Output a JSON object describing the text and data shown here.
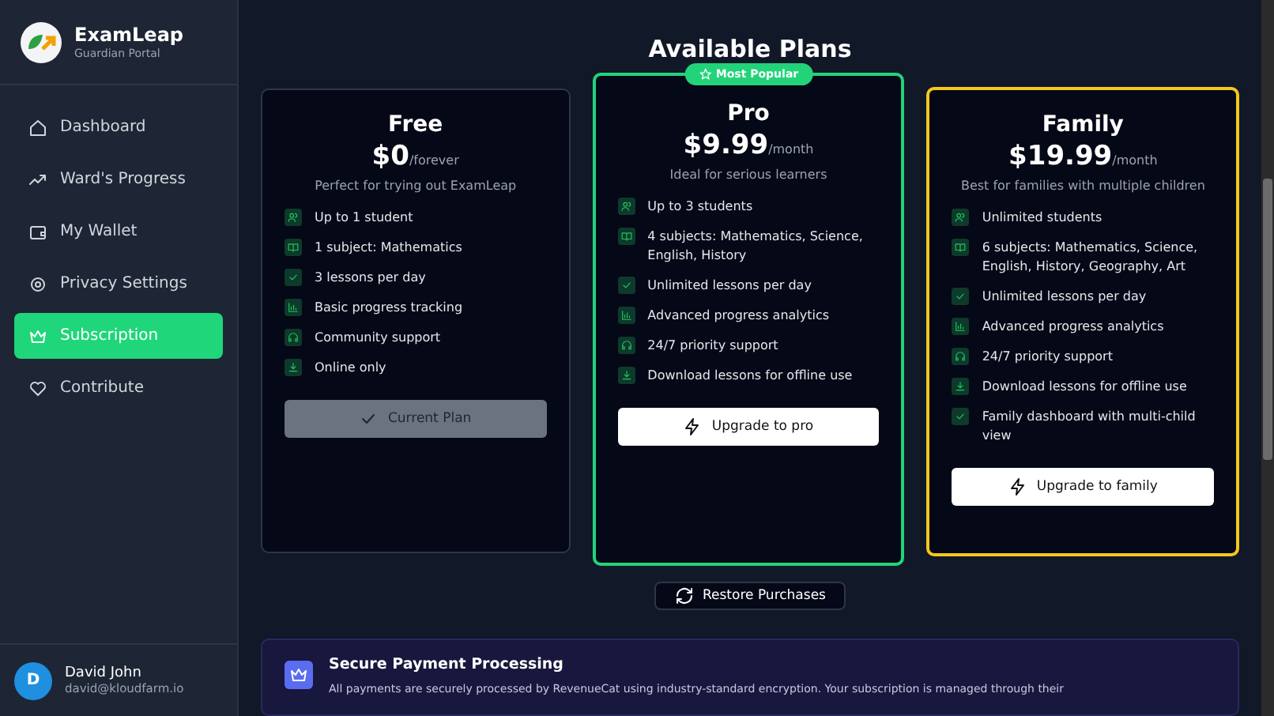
{
  "brand": {
    "name": "ExamLeap",
    "subtitle": "Guardian Portal"
  },
  "sidebar": {
    "items": [
      {
        "label": "Dashboard",
        "kind": "home",
        "selected": false
      },
      {
        "label": "Ward's Progress",
        "kind": "trend",
        "selected": false
      },
      {
        "label": "My Wallet",
        "kind": "wallet",
        "selected": false
      },
      {
        "label": "Privacy Settings",
        "kind": "gear",
        "selected": false
      },
      {
        "label": "Subscription",
        "kind": "crown",
        "selected": true
      },
      {
        "label": "Contribute",
        "kind": "heart",
        "selected": false
      }
    ]
  },
  "user": {
    "initial": "D",
    "name": "David John",
    "email": "david@kloudfarm.io"
  },
  "title": "Available Plans",
  "plans": [
    {
      "kind": "basic",
      "name": "Free",
      "price": "$0",
      "period": "/forever",
      "tagline": "Perfect for trying out ExamLeap",
      "features": [
        {
          "kind": "users",
          "text": "Up to 1 student"
        },
        {
          "kind": "book",
          "text": "1 subject: Mathematics"
        },
        {
          "kind": "check",
          "text": "3 lessons per day"
        },
        {
          "kind": "chart",
          "text": "Basic progress tracking"
        },
        {
          "kind": "headset",
          "text": "Community support"
        },
        {
          "kind": "download",
          "text": "Online only"
        }
      ],
      "button": {
        "kind": "current",
        "label": "Current Plan",
        "disabled": true
      }
    },
    {
      "kind": "popular",
      "badge": "Most Popular",
      "name": "Pro",
      "price": "$9.99",
      "period": "/month",
      "tagline": "Ideal for serious learners",
      "features": [
        {
          "kind": "users",
          "text": "Up to 3 students"
        },
        {
          "kind": "book",
          "text": "4 subjects: Mathematics, Science, English, History"
        },
        {
          "kind": "check",
          "text": "Unlimited lessons per day"
        },
        {
          "kind": "chart",
          "text": "Advanced progress analytics"
        },
        {
          "kind": "headset",
          "text": "24/7 priority support"
        },
        {
          "kind": "download",
          "text": "Download lessons for offline use"
        }
      ],
      "button": {
        "kind": "upgrade",
        "label": "Upgrade to pro",
        "disabled": false
      }
    },
    {
      "kind": "premium",
      "name": "Family",
      "price": "$19.99",
      "period": "/month",
      "tagline": "Best for families with multiple children",
      "features": [
        {
          "kind": "users",
          "text": "Unlimited students"
        },
        {
          "kind": "book",
          "text": "6 subjects: Mathematics, Science, English, History, Geography, Art"
        },
        {
          "kind": "check",
          "text": "Unlimited lessons per day"
        },
        {
          "kind": "chart",
          "text": "Advanced progress analytics"
        },
        {
          "kind": "headset",
          "text": "24/7 priority support"
        },
        {
          "kind": "download",
          "text": "Download lessons for offline use"
        },
        {
          "kind": "check",
          "text": "Family dashboard with multi-child view"
        }
      ],
      "button": {
        "kind": "upgrade",
        "label": "Upgrade to family",
        "disabled": false
      }
    }
  ],
  "restore_button": "Restore Purchases",
  "secure": {
    "title": "Secure Payment Processing",
    "text": "All payments are securely processed by RevenueCat using industry-standard encryption. Your subscription is managed through their"
  }
}
